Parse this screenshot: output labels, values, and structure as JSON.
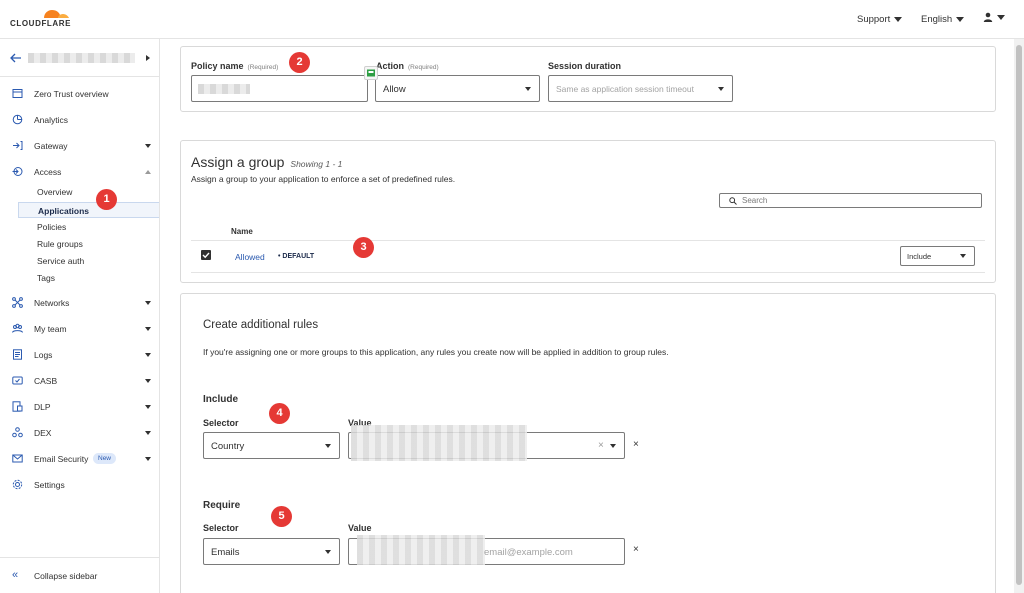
{
  "brand": {
    "name": "CLOUDFLARE",
    "accent": "#f6821f"
  },
  "topbar": {
    "support_label": "Support",
    "language_label": "English",
    "user_icon": "user-icon"
  },
  "sidebar": {
    "items": [
      {
        "label": "Zero Trust overview",
        "icon": "overview-icon"
      },
      {
        "label": "Analytics",
        "icon": "analytics-icon"
      },
      {
        "label": "Gateway",
        "icon": "gateway-icon"
      },
      {
        "label": "Access",
        "icon": "access-icon"
      },
      {
        "label": "Networks",
        "icon": "networks-icon"
      },
      {
        "label": "My team",
        "icon": "team-icon"
      },
      {
        "label": "Logs",
        "icon": "logs-icon"
      },
      {
        "label": "CASB",
        "icon": "casb-icon"
      },
      {
        "label": "DLP",
        "icon": "dlp-icon"
      },
      {
        "label": "DEX",
        "icon": "dex-icon"
      },
      {
        "label": "Email Security",
        "icon": "email-icon",
        "badge": "New"
      },
      {
        "label": "Settings",
        "icon": "settings-icon"
      }
    ],
    "access_sub": [
      "Overview",
      "Applications",
      "Policies",
      "Rule groups",
      "Service auth",
      "Tags"
    ],
    "active_sub": "Applications",
    "collapse_label": "Collapse sidebar"
  },
  "markers": [
    "1",
    "2",
    "3",
    "4",
    "5"
  ],
  "policy": {
    "name_label": "Policy name",
    "action_label": "Action",
    "required_text": "(Required)",
    "action_value": "Allow",
    "session_label": "Session duration",
    "session_placeholder": "Same as application session timeout"
  },
  "assign_group": {
    "title": "Assign a group",
    "showing": "Showing 1 - 1",
    "description": "Assign a group to your application to enforce a set of predefined rules.",
    "search_placeholder": "Search",
    "column_name": "Name",
    "rows": [
      {
        "name": "Allowed",
        "tag": "• DEFAULT",
        "mode": "Include",
        "checked": true
      }
    ]
  },
  "rules": {
    "title": "Create additional rules",
    "description": "If you're assigning one or more groups to this application, any rules you create now will be applied in addition to group rules.",
    "include": {
      "heading": "Include",
      "selector_label": "Selector",
      "value_label": "Value",
      "selector_value": "Country"
    },
    "require": {
      "heading": "Require",
      "selector_label": "Selector",
      "value_label": "Value",
      "selector_value": "Emails",
      "value_placeholder": "email@example.com"
    },
    "remove_glyph": "×",
    "clear_glyph": "×"
  }
}
